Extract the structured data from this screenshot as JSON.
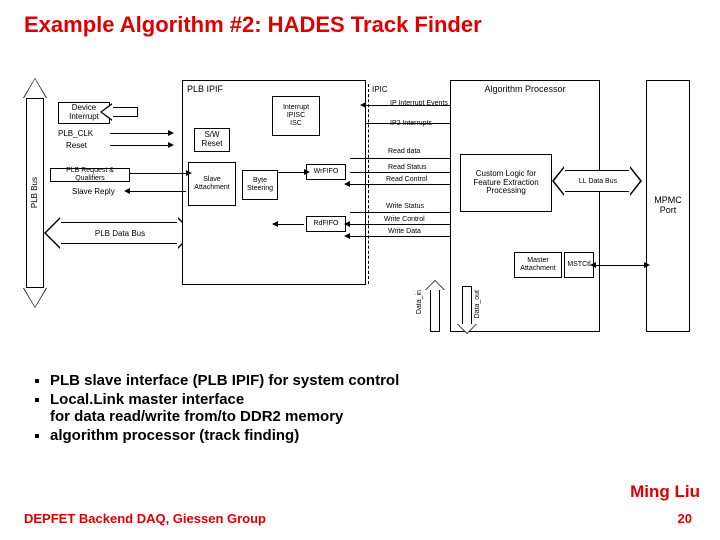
{
  "title": "Example Algorithm #2: HADES Track Finder",
  "diagram": {
    "plb_bus": "PLB Bus",
    "device_interrupt": "Device Interrupt",
    "plb_clk": "PLB_CLK",
    "reset": "Reset",
    "plb_req": "PLB Request & Qualifiers",
    "slave_reply": "Slave Reply",
    "plb_data_bus": "PLB Data Bus",
    "plb_ipif": "PLB IPIF",
    "sw_reset": "S/W Reset",
    "slave_attach": "Slave Attachment",
    "byte_steer": "Byte Steering",
    "interrupt_box": "Interrupt\nIPISC\nISC",
    "ipic": "IPIC",
    "ip_interrupt_events": "IP Interrupt Events",
    "ip2_interrupts": "IP2 Interrupts",
    "wrfifo": "WrFIFO",
    "rdfifo": "RdFIFO",
    "read_data": "Read data",
    "read_status": "Read Status",
    "read_control": "Read Control",
    "write_status": "Write Status",
    "write_control": "Write Control",
    "write_data": "Write Data",
    "alg_proc": "Algorithm Processor",
    "custom_logic": "Custom Logic for Feature Extraction Processing",
    "master_attach": "Master Attachment",
    "mst_ctl": "MSTCtl",
    "ll_data_bus": "LL Data Bus",
    "mpmc": "MPMC Port",
    "data_in": "Data_in",
    "data_out": "Data_out"
  },
  "bullets": [
    "PLB slave interface (PLB IPIF) for system control",
    "Local.Link master interface",
    "for data read/write from/to DDR2 memory",
    "algorithm processor (track finding)"
  ],
  "author": "Ming Liu",
  "footer": "DEPFET Backend DAQ, Giessen Group",
  "pagenum": "20"
}
